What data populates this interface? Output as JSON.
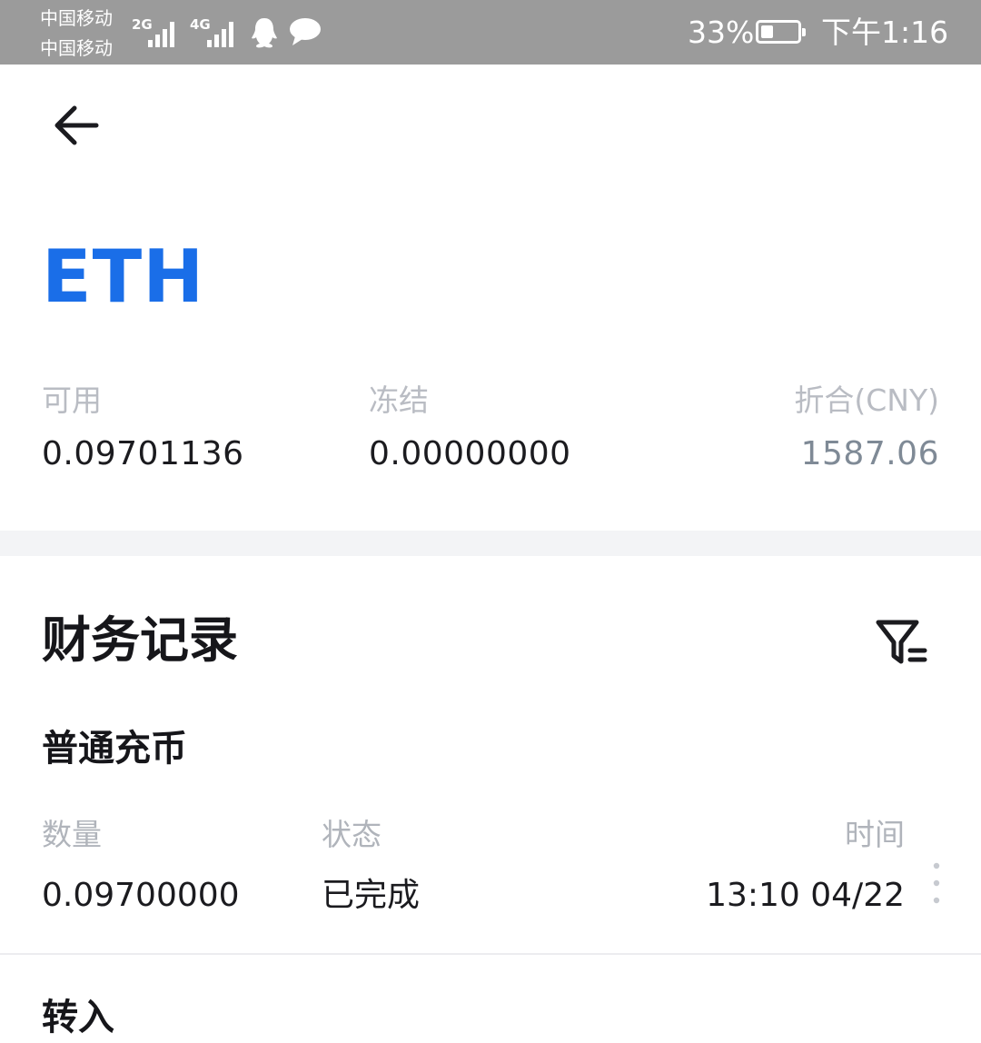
{
  "status_bar": {
    "carrier_1": "中国移动",
    "carrier_2": "中国移动",
    "network_1": "2G",
    "network_2": "4G",
    "battery_percent": "33%",
    "battery_level": 0.33,
    "time": "下午1:16",
    "icons": [
      "signal-icon",
      "qq-icon",
      "message-icon",
      "battery-icon"
    ]
  },
  "header": {
    "back_icon": "arrow-left-icon",
    "coin": "ETH"
  },
  "balances": {
    "available_label": "可用",
    "available_value": "0.09701136",
    "frozen_label": "冻结",
    "frozen_value": "0.00000000",
    "converted_label": "折合(CNY)",
    "converted_value": "1587.06"
  },
  "records": {
    "title": "财务记录",
    "filter_icon": "filter-icon",
    "items": [
      {
        "type": "普通充币",
        "amount_label": "数量",
        "amount": "0.09700000",
        "status_label": "状态",
        "status": "已完成",
        "time_label": "时间",
        "time": "13:10 04/22"
      }
    ],
    "next_type": "转入"
  },
  "colors": {
    "accent": "#1a6ee8",
    "status_bar": "#9b9b9b",
    "muted_label": "#b9bcc3",
    "converted_value": "#7f8a96",
    "band": "#f3f4f6"
  }
}
